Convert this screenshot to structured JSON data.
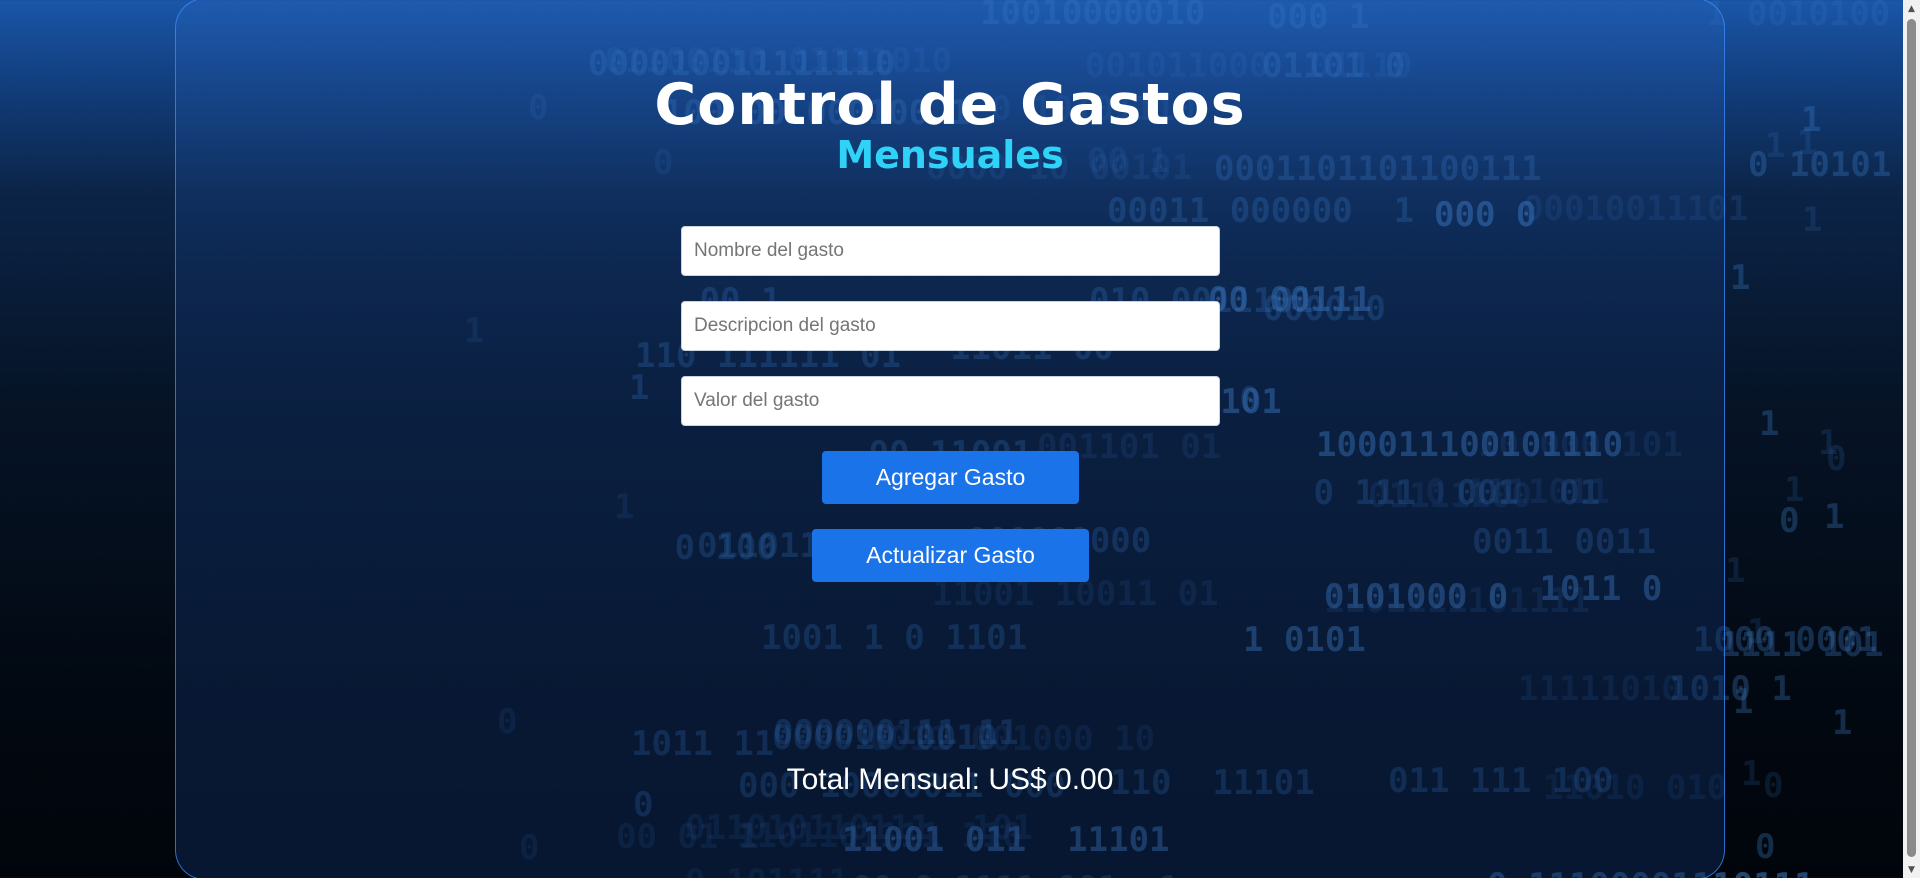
{
  "header": {
    "title": "Control de Gastos",
    "subtitle": "Mensuales"
  },
  "form": {
    "name_placeholder": "Nombre del gasto",
    "description_placeholder": "Descripcion del gasto",
    "value_placeholder": "Valor del gasto",
    "add_button_label": "Agregar Gasto",
    "update_button_label": "Actualizar Gasto"
  },
  "summary": {
    "total_label": "Total Mensual: US$ 0.00"
  },
  "colors": {
    "accent_button": "#1a73e8",
    "subtitle_cyan": "#2fd3f7",
    "panel_border": "#3c8cff"
  },
  "scrollbar": {
    "up_icon": "chevron-up-icon",
    "down_icon": "chevron-down-icon"
  }
}
